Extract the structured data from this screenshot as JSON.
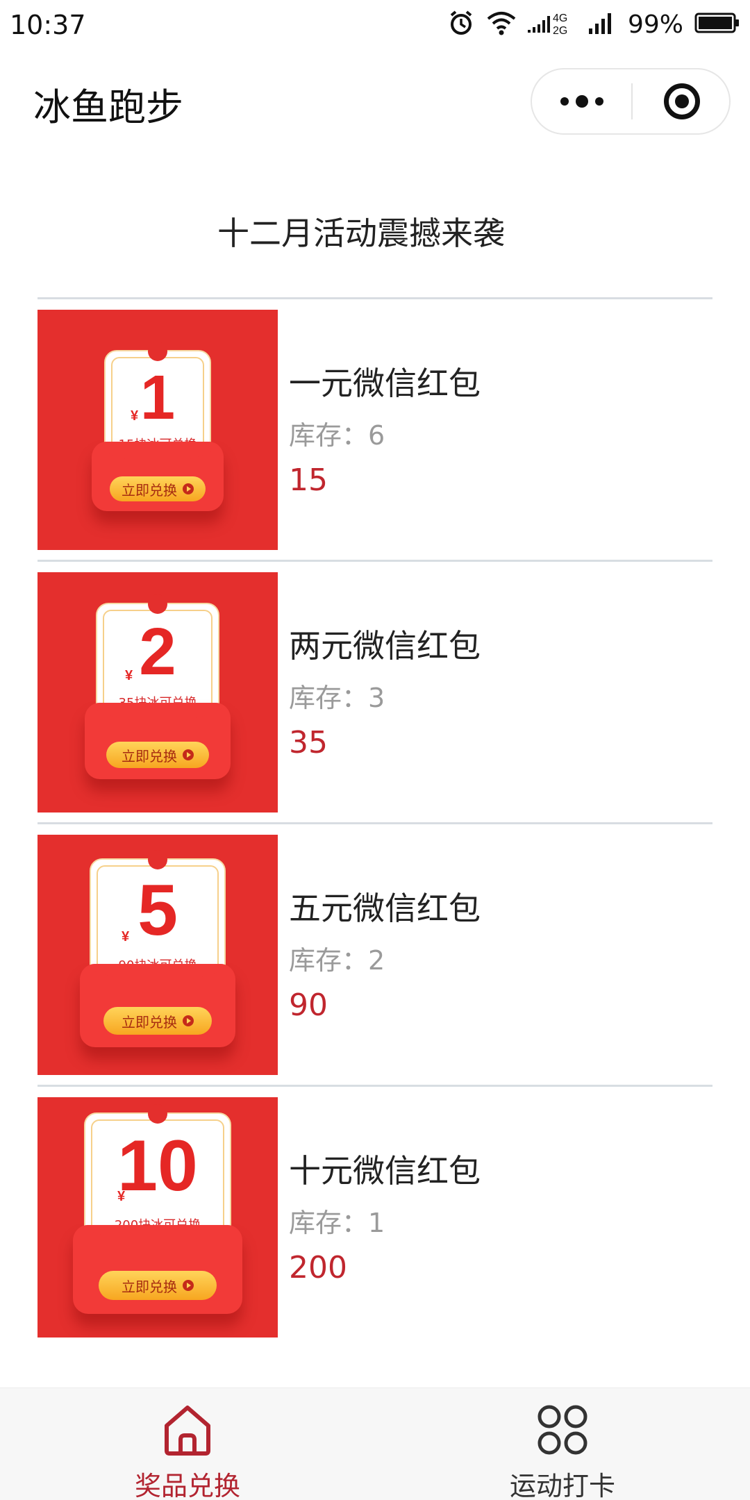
{
  "status_bar": {
    "time": "10:37",
    "network": "4G 2G",
    "battery": "99%",
    "icons": [
      "alarm-icon",
      "wifi-icon",
      "signal-4g-2g-icon",
      "signal-icon",
      "battery-icon"
    ]
  },
  "titlebar": {
    "title": "冰鱼跑步",
    "more_icon": "more-dots-icon",
    "close_icon": "target-circle-icon"
  },
  "heading": "十二月活动震撼来袭",
  "prizes": [
    {
      "name": "一元微信红包",
      "stock": "库存：6",
      "price": "15",
      "card_amount": "1",
      "card_sub": "15块冰可兑换",
      "card_button": "立即兑换"
    },
    {
      "name": "两元微信红包",
      "stock": "库存：3",
      "price": "35",
      "card_amount": "2",
      "card_sub": "35块冰可兑换",
      "card_button": "立即兑换"
    },
    {
      "name": "五元微信红包",
      "stock": "库存：2",
      "price": "90",
      "card_amount": "5",
      "card_sub": "90块冰可兑换",
      "card_button": "立即兑换"
    },
    {
      "name": "十元微信红包",
      "stock": "库存：1",
      "price": "200",
      "card_amount": "10",
      "card_sub": "200块冰可兑换",
      "card_button": "立即兑换"
    }
  ],
  "card_currency": "¥",
  "tabbar": {
    "tabs": [
      {
        "label": "奖品兑换",
        "icon": "home-icon",
        "active": true
      },
      {
        "label": "运动打卡",
        "icon": "four-circles-icon",
        "active": false
      }
    ]
  },
  "colors": {
    "accent": "#b22430",
    "price": "#c0262e",
    "card_bg": "#e42f2d",
    "stock_text": "#9a9a9a"
  }
}
